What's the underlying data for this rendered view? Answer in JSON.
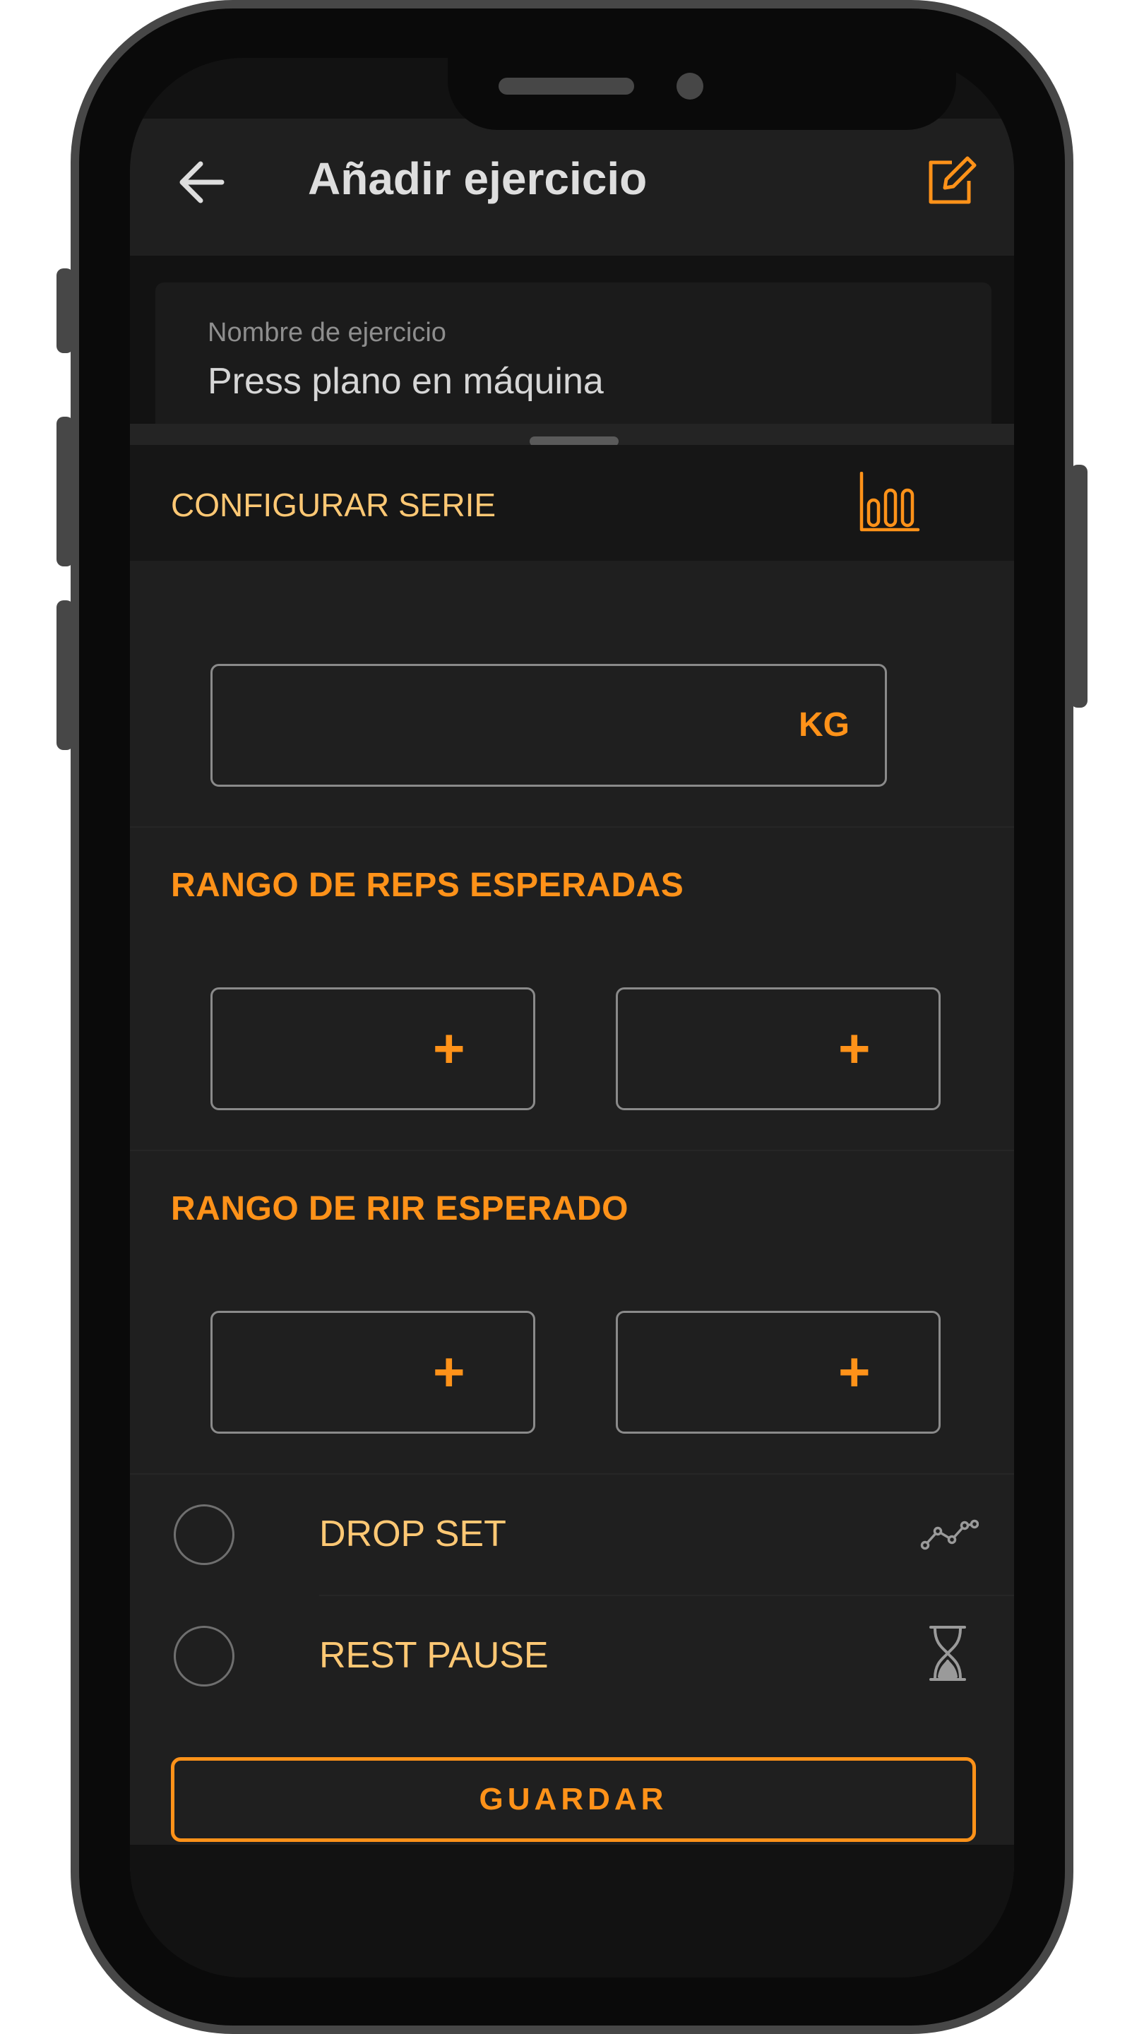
{
  "colors": {
    "accent": "#ff9219",
    "accent_light": "#ffc874",
    "background": "#1f1f1f"
  },
  "appbar": {
    "title": "Añadir ejercicio",
    "back_icon": "arrow-left-icon",
    "edit_icon": "edit-square-icon"
  },
  "exercise_field": {
    "label": "Nombre de ejercicio",
    "value": "Press plano en máquina"
  },
  "sheet": {
    "header_label": "CONFIGURAR SERIE",
    "header_icon": "bar-chart-icon",
    "weight": {
      "unit": "KG"
    },
    "reps": {
      "heading": "RANGO DE REPS ESPERADAS",
      "min_icon": "plus",
      "max_icon": "plus"
    },
    "rir": {
      "heading": "RANGO DE RIR ESPERADO",
      "min_icon": "plus",
      "max_icon": "plus"
    },
    "options": [
      {
        "label": "DROP SET",
        "icon": "line-chart-icon",
        "checked": false
      },
      {
        "label": "REST PAUSE",
        "icon": "hourglass-icon",
        "checked": false
      }
    ],
    "save_label": "GUARDAR"
  }
}
